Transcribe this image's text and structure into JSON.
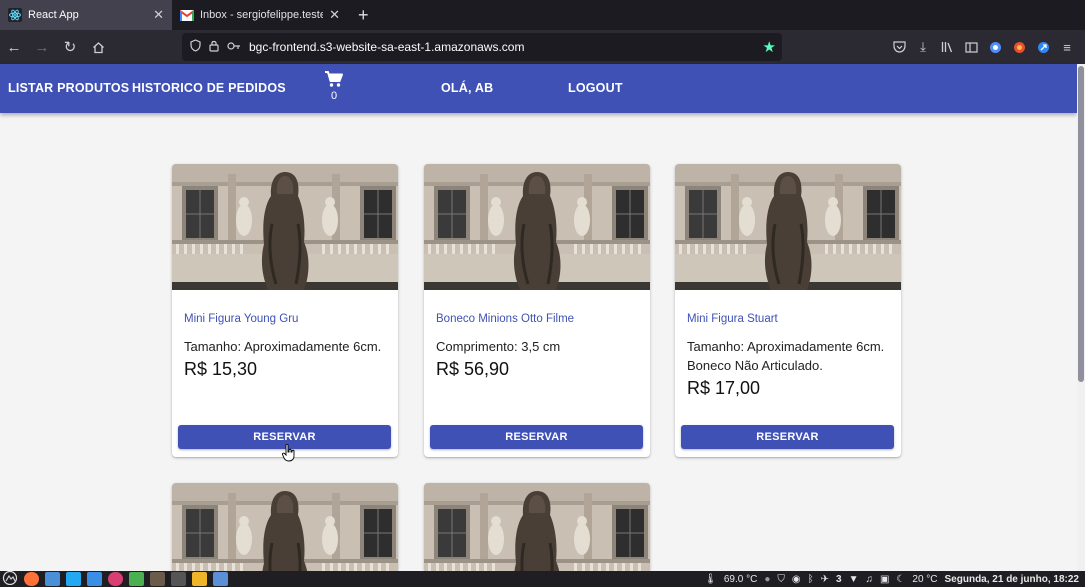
{
  "browser": {
    "tabs": [
      {
        "title": "React App",
        "favicon": "react-favicon",
        "active": true
      },
      {
        "title": "Inbox - sergiofelippe.teste@",
        "favicon": "gmail-favicon",
        "active": false
      }
    ],
    "new_tab": "+",
    "url": "bgc-frontend.s3-website-sa-east-1.amazonaws.com"
  },
  "appbar": {
    "listar": "LISTAR PRODUTOS",
    "historico": "HISTORICO DE PEDIDOS",
    "cart_count": "0",
    "greeting": "OLÁ, AB",
    "logout": "LOGOUT"
  },
  "products": [
    {
      "title": "Mini Figura Young Gru",
      "desc": "Tamanho: Aproximadamente 6cm.",
      "price": "R$ 15,30",
      "button": "RESERVAR"
    },
    {
      "title": "Boneco Minions Otto Filme",
      "desc": "Comprimento: 3,5 cm",
      "price": "R$ 56,90",
      "button": "RESERVAR"
    },
    {
      "title": "Mini Figura Stuart",
      "desc": "Tamanho: Aproximadamente 6cm. Boneco Não Articulado.",
      "price": "R$ 17,00",
      "button": "RESERVAR"
    }
  ],
  "taskbar": {
    "cpu_temp": "69.0 °C",
    "updates": "3",
    "weather": "20 °C",
    "clock": "Segunda, 21 de junho, 18:22"
  },
  "colors": {
    "primary": "#3f51b5",
    "tab_active": "#42414d",
    "chrome_bg": "#1c1b22",
    "page_bg": "#f4f4f4"
  }
}
